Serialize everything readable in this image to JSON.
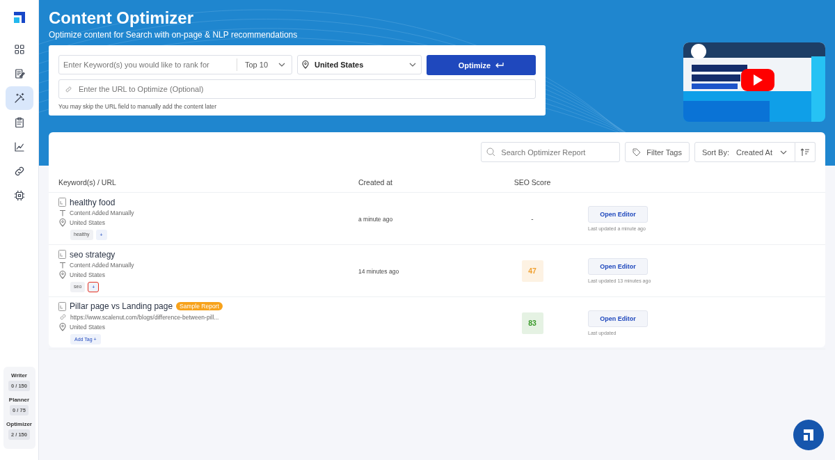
{
  "sidebar": {
    "nav_items": [
      {
        "kind": "dashboard",
        "selected": false
      },
      {
        "kind": "writer",
        "selected": false
      },
      {
        "kind": "optimizer",
        "selected": true
      },
      {
        "kind": "planner",
        "selected": false
      },
      {
        "kind": "analytics",
        "selected": false
      },
      {
        "kind": "links",
        "selected": false
      },
      {
        "kind": "chip",
        "selected": false
      }
    ],
    "usage": [
      {
        "label": "Writer",
        "count": "0 / 150"
      },
      {
        "label": "Planner",
        "count": "0 / 75"
      },
      {
        "label": "Optimizer",
        "count": "2 / 150"
      }
    ]
  },
  "header": {
    "title": "Content Optimizer",
    "subtitle": "Optimize content for Search with on-page & NLP recommendations"
  },
  "form": {
    "keyword_placeholder": "Enter Keyword(s) you would like to rank for",
    "top": "Top 10",
    "location": "United States",
    "optimize_button": "Optimize",
    "url_placeholder": "Enter the URL to Optimize (Optional)",
    "hint": "You may skip the URL field to manually add the content later"
  },
  "toolbar": {
    "search_placeholder": "Search Optimizer Report",
    "filter_button": "Filter Tags",
    "sort_label": "Sort By:",
    "sort_value": "Created At"
  },
  "table": {
    "columns": [
      "Keyword(s) / URL",
      "Created at",
      "SEO Score"
    ],
    "rows": [
      {
        "keyword": "healthy food",
        "source": {
          "kind": "manual",
          "text": "Content Added Manually"
        },
        "location": "United States",
        "tags": [
          {
            "kind": "tag",
            "label": "healthy"
          },
          {
            "kind": "add",
            "label": "+",
            "highlighted": false
          }
        ],
        "created": "a minute ago",
        "score": {
          "value": "-"
        },
        "action": "Open Editor",
        "updated": "Last updated a minute ago"
      },
      {
        "keyword": "seo strategy",
        "source": {
          "kind": "manual",
          "text": "Content Added Manually"
        },
        "location": "United States",
        "tags": [
          {
            "kind": "tag",
            "label": "seo"
          },
          {
            "kind": "add",
            "label": "+",
            "highlighted": true
          }
        ],
        "created": "14 minutes ago",
        "score": {
          "value": "47",
          "color": "#f0a030"
        },
        "action": "Open Editor",
        "updated": "Last updated 13 minutes ago"
      },
      {
        "keyword": "Pillar page vs Landing page",
        "badge": "Sample Report",
        "source": {
          "kind": "url",
          "text": "https://www.scalenut.com/blogs/difference-between-pill..."
        },
        "location": "United States",
        "tags": [
          {
            "kind": "add",
            "label": "Add Tag +",
            "highlighted": false
          }
        ],
        "score": {
          "value": "83",
          "color": "#3a9a2a"
        },
        "action": "Open Editor",
        "updated": "Last updated"
      }
    ]
  }
}
